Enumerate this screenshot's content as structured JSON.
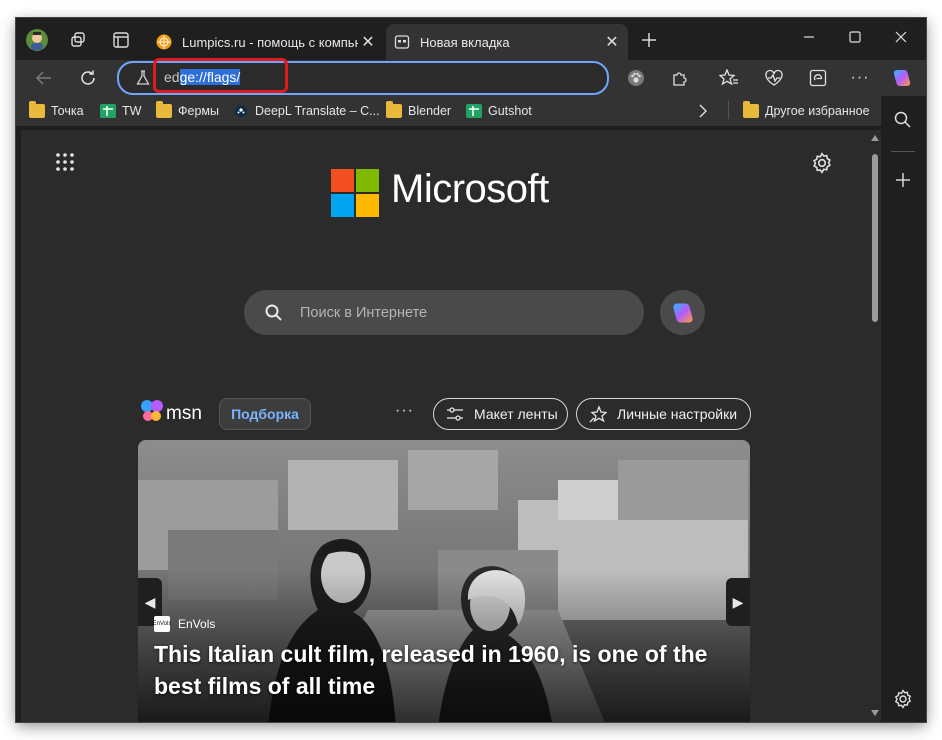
{
  "tabs": [
    {
      "title": "Lumpics.ru - помощь с компьюте",
      "active": false
    },
    {
      "title": "Новая вкладка",
      "active": true
    }
  ],
  "address_bar": {
    "url_dim": "ed",
    "url_selected": "ge://flags/"
  },
  "bookmarks": [
    {
      "label": "Точка",
      "icon": "folder-icon"
    },
    {
      "label": "TW",
      "icon": "sheets-icon"
    },
    {
      "label": "Фермы",
      "icon": "folder-icon"
    },
    {
      "label": "DeepL Translate – C...",
      "icon": "deepl-icon"
    },
    {
      "label": "Blender",
      "icon": "folder-icon"
    },
    {
      "label": "Gutshot",
      "icon": "sheets-icon"
    }
  ],
  "other_bookmarks": "Другое избранное",
  "brand": {
    "name": "Microsoft"
  },
  "search": {
    "placeholder": "Поиск в Интернете"
  },
  "msn": {
    "name": "msn",
    "pick_label": "Подборка",
    "more_label": "···",
    "layout_label": "Макет ленты",
    "personalize_label": "Личные настройки"
  },
  "hero": {
    "source": "EnVols",
    "source_logo_text": "EnVols",
    "headline": "This Italian cult film, released in 1960, is one of the best films of all time"
  },
  "colors": {
    "accent": "#6ea6ff",
    "highlight": "#e01b1b",
    "selection": "#2d6fd6"
  }
}
